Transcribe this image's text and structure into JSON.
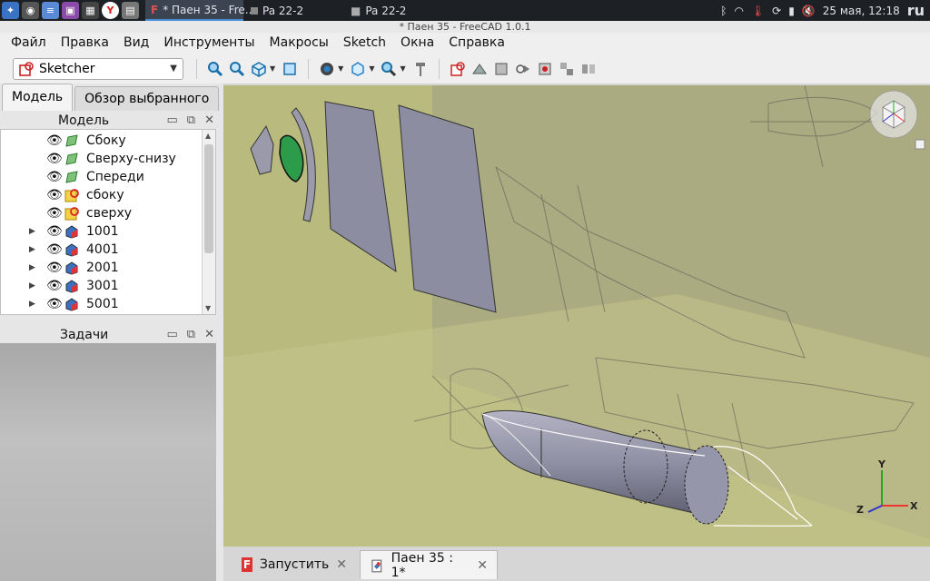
{
  "taskbar": {
    "tasks": [
      {
        "label": "* Паен 35 - Fre..."
      },
      {
        "label": "Pa 22-2"
      },
      {
        "label": "Pa 22-2"
      }
    ],
    "clock": "25 мая, 12:18",
    "lang": "ru"
  },
  "window": {
    "title": "* Паен 35 - FreeCAD 1.0.1"
  },
  "menu": [
    "Файл",
    "Правка",
    "Вид",
    "Инструменты",
    "Макросы",
    "Sketch",
    "Окна",
    "Справка"
  ],
  "toolbar": {
    "workbench": "Sketcher"
  },
  "left_tabs": [
    "Модель",
    "Обзор выбранного"
  ],
  "model_panel": {
    "title": "Модель",
    "items": [
      {
        "label": "Сбоку",
        "icon": "sketch-green-icon",
        "expandable": false
      },
      {
        "label": "Сверху-снизу",
        "icon": "sketch-green-icon",
        "expandable": false
      },
      {
        "label": "Спереди",
        "icon": "sketch-green-icon",
        "expandable": false
      },
      {
        "label": "сбоку",
        "icon": "image-plane-icon",
        "expandable": false
      },
      {
        "label": "сверху",
        "icon": "image-plane-icon",
        "expandable": false
      },
      {
        "label": "1001",
        "icon": "part-solid-icon",
        "expandable": true
      },
      {
        "label": "4001",
        "icon": "part-solid-icon",
        "expandable": true
      },
      {
        "label": "2001",
        "icon": "part-solid-icon",
        "expandable": true
      },
      {
        "label": "3001",
        "icon": "part-solid-icon",
        "expandable": true
      },
      {
        "label": "5001",
        "icon": "part-solid-icon",
        "expandable": true
      }
    ]
  },
  "tasks_panel": {
    "title": "Задачи"
  },
  "axes": {
    "x": "X",
    "y": "Y",
    "z": "Z"
  },
  "doc_tabs": [
    {
      "label": "Запустить",
      "icon": "freecad-start-icon"
    },
    {
      "label": "Паен 35 : 1*",
      "icon": "document-icon"
    }
  ],
  "colors": {
    "viewport_bg": "#b9bb7e",
    "solid": "#8f8fa3",
    "sketch_green": "#2c9c4b"
  }
}
